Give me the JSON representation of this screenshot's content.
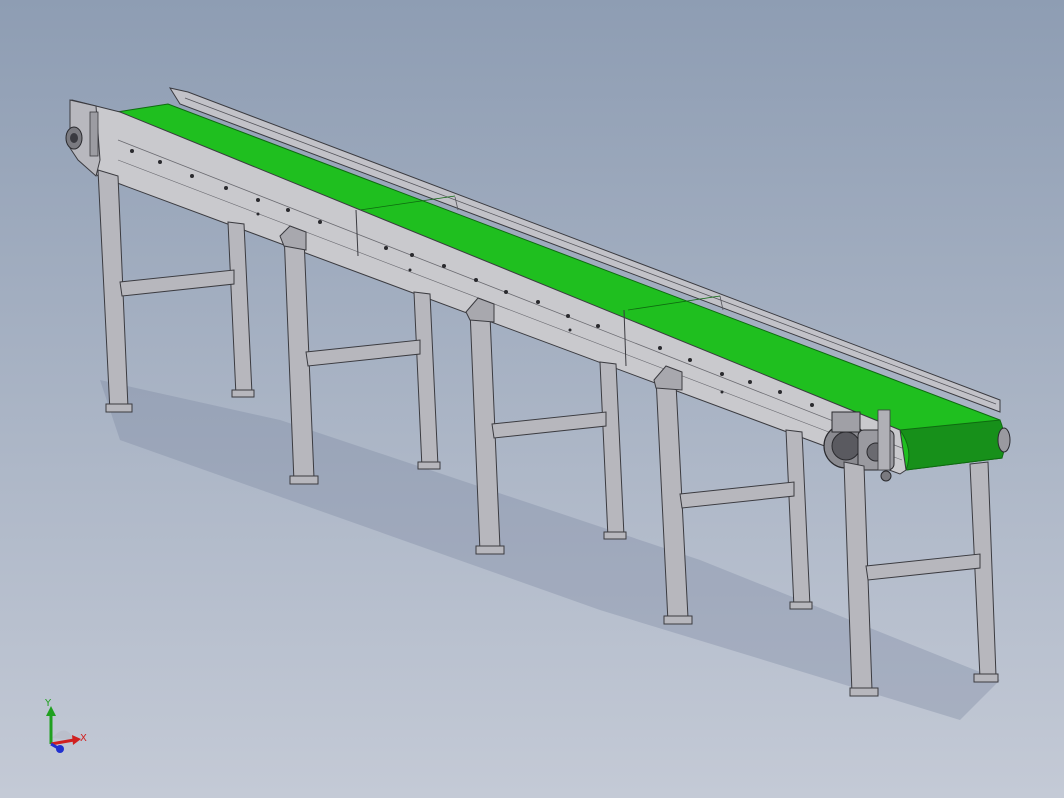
{
  "viewport": {
    "background_top": "#8e9db3",
    "background_bottom": "#c4cad6"
  },
  "model": {
    "belt_color": "#1fbf1f",
    "belt_shadow": "#17901a",
    "frame_color": "#c9c9cd",
    "frame_dark": "#9a9aa0",
    "frame_outline": "#3b3b40",
    "leg_color": "#b7b7bd",
    "hole_color": "#2a2a2e"
  },
  "triad": {
    "x_label": "X",
    "y_label": "Y",
    "x_color": "#d02020",
    "y_color": "#20a020",
    "z_color": "#2030d0",
    "x_icon": "x-axis-arrow",
    "y_icon": "y-axis-arrow",
    "z_icon": "z-axis-arrow"
  }
}
